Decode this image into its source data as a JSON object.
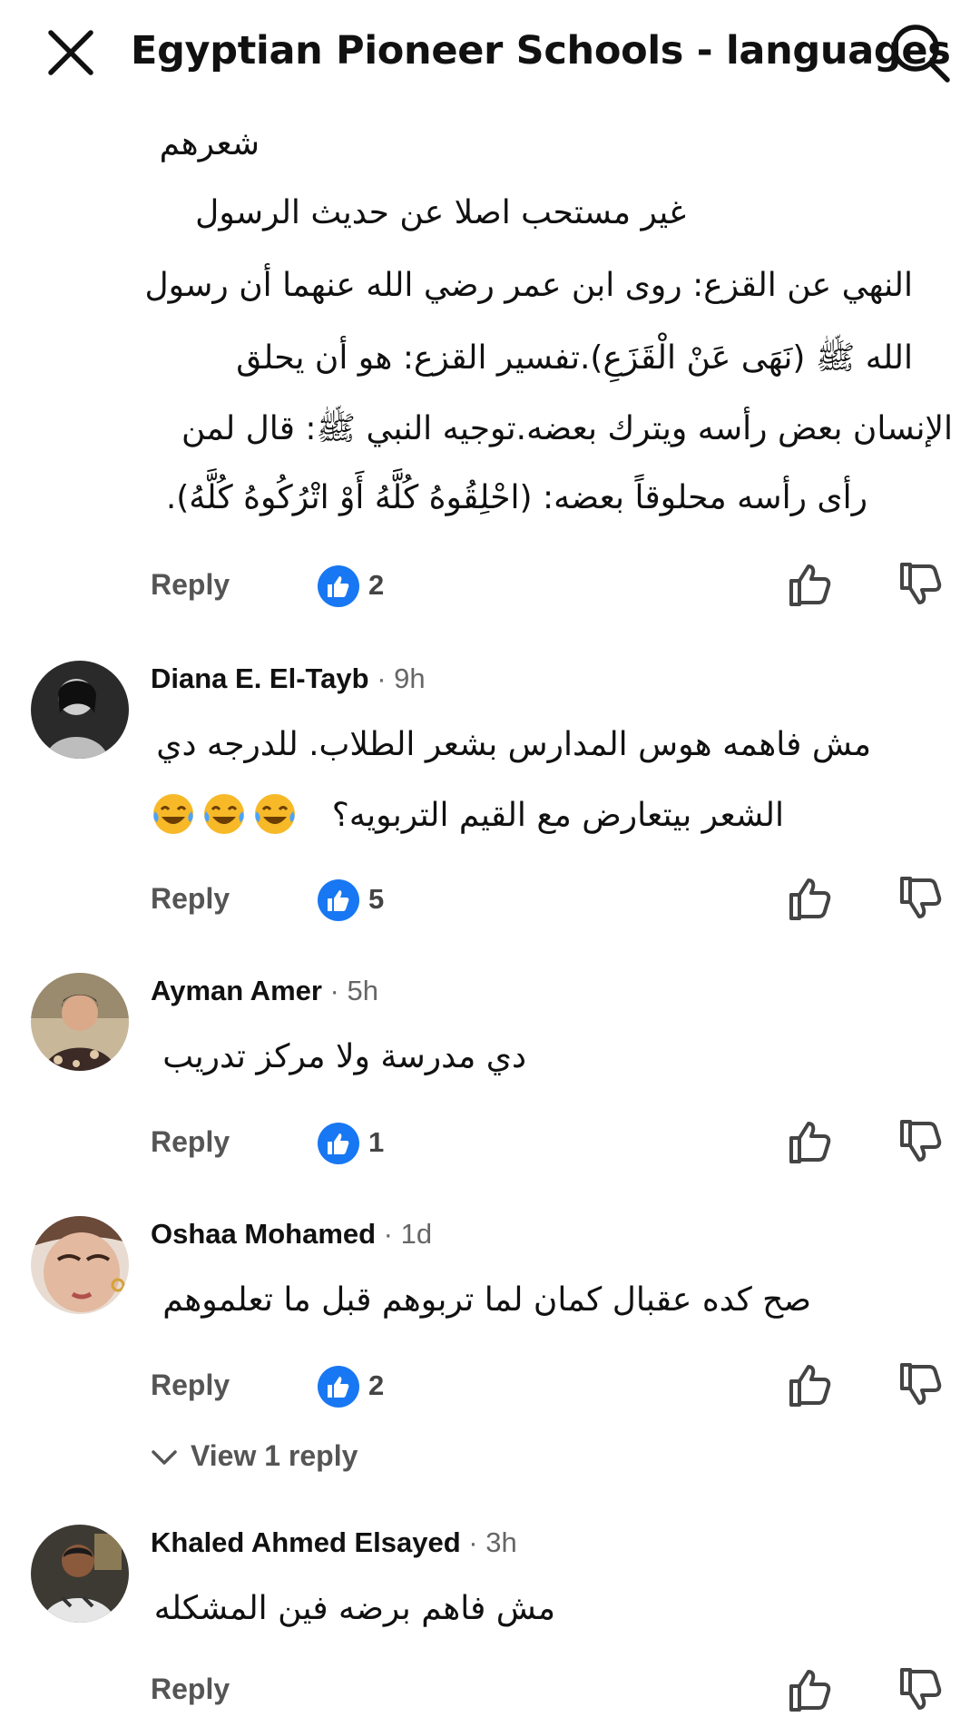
{
  "header": {
    "title": "Egyptian Pioneer Schools - languages",
    "close_icon": "close-icon",
    "search_icon": "search-icon"
  },
  "colors": {
    "like_blue": "#1877F2",
    "text_primary": "#111111",
    "text_secondary": "#555555",
    "timestamp": "#666666"
  },
  "first_comment": {
    "lines": [
      "شعرهم",
      "غير مستحب اصلا عن حديث الرسول",
      "النهي عن القزع: روى ابن عمر رضي الله عنهما أن رسول",
      "الله ﷺ (نَهَى عَنْ الْقَزَعِ).تفسير القزع: هو أن يحلق",
      "الإنسان بعض رأسه ويترك بعضه.توجيه النبي ﷺ: قال لمن",
      "رأى رأسه محلوقاً بعضه: (احْلِقُوهُ كُلَّهُ أَوْ اتْرُكُوهُ كُلَّهُ)."
    ],
    "reply_label": "Reply",
    "likes": "2"
  },
  "comments": [
    {
      "name": "Diana E. El-Tayb",
      "time": " · 9h",
      "lines": [
        "مش فاهمه هوس المدارس بشعر الطلاب. للدرجه دي",
        "الشعر بيتعارض مع القيم التربويه؟"
      ],
      "emoji": [
        "laughing-tears-emoji",
        "laughing-tears-emoji",
        "laughing-tears-emoji"
      ],
      "reply_label": "Reply",
      "likes": "5"
    },
    {
      "name": "Ayman Amer",
      "time": " · 5h",
      "lines": [
        "دي مدرسة ولا مركز تدريب"
      ],
      "reply_label": "Reply",
      "likes": "1"
    },
    {
      "name": "Oshaa Mohamed",
      "time": " · 1d",
      "lines": [
        "صح كده عقبال كمان لما تربوهم قبل ما تعلموهم"
      ],
      "reply_label": "Reply",
      "likes": "2",
      "view_replies": "View 1 reply"
    },
    {
      "name": "Khaled Ahmed Elsayed",
      "time": " · 3h",
      "lines": [
        "مش فاهم برضه فين المشكله"
      ],
      "reply_label": "Reply"
    }
  ]
}
